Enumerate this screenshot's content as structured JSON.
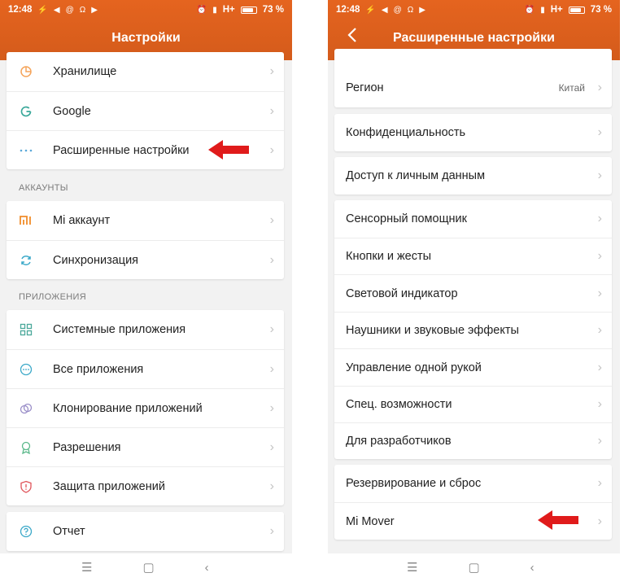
{
  "left": {
    "status": {
      "time": "12:48",
      "network": "H+",
      "battery": "73 %",
      "battery_level": 0.73
    },
    "title": "Настройки",
    "group1": [
      "Хранилище",
      "Google",
      "Расширенные настройки"
    ],
    "section_accounts": "АККАУНТЫ",
    "accounts": [
      "Mi аккаунт",
      "Синхронизация"
    ],
    "section_apps": "ПРИЛОЖЕНИЯ",
    "apps": [
      "Системные приложения",
      "Все приложения",
      "Клонирование приложений",
      "Разрешения",
      "Защита приложений"
    ],
    "report": "Отчет",
    "icons": {
      "storage": "storage-pie-icon",
      "google": "google-g-icon",
      "advanced": "dots-icon",
      "mi": "mi-logo-icon",
      "sync": "sync-icon",
      "system_apps": "grid-icon",
      "all_apps": "chat-dots-icon",
      "clone": "clone-icon",
      "permissions": "badge-icon",
      "protection": "shield-icon",
      "report": "help-circle-icon"
    }
  },
  "right": {
    "status": {
      "time": "12:48",
      "network": "H+",
      "battery": "73 %",
      "battery_level": 0.73
    },
    "title": "Расширенные настройки",
    "region": {
      "label": "Регион",
      "value": "Китай"
    },
    "privacy": "Конфиденциальность",
    "personal_data": "Доступ к личным данным",
    "controls": [
      "Сенсорный помощник",
      "Кнопки и жесты",
      "Световой индикатор",
      "Наушники и звуковые эффекты",
      "Управление одной рукой",
      "Спец. возможности",
      "Для разработчиков"
    ],
    "backup": [
      "Резервирование и сброс",
      "Mi Mover"
    ]
  },
  "nav": {
    "menu": "☰",
    "home": "▢",
    "back": "‹"
  },
  "colors": {
    "accent": "#e05f1d",
    "arrow": "#e01b1b",
    "chevron": "#c4c4c4"
  }
}
